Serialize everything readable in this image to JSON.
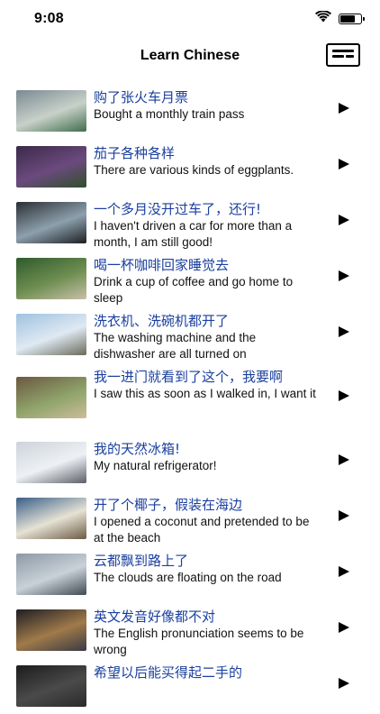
{
  "status_bar": {
    "time": "9:08",
    "battery_level": 0.8
  },
  "nav": {
    "title": "Learn Chinese",
    "menu_icon": "card-menu-icon"
  },
  "lessons": [
    {
      "zh": "购了张火车月票",
      "en": "Bought a monthly train pass",
      "thumb": [
        "#7a8a93",
        "#c8d1c9",
        "#3f6e4a"
      ]
    },
    {
      "zh": "茄子各种各样",
      "en": "There are various kinds of eggplants.",
      "thumb": [
        "#3b2a48",
        "#6b4a7e",
        "#2f4f2a"
      ]
    },
    {
      "zh": "一个多月没开过车了，还行!",
      "en": "I haven't driven a car for more than a month, I am still good!",
      "thumb": [
        "#2b2f35",
        "#8da0ad",
        "#1d1f22"
      ]
    },
    {
      "zh": "喝一杯咖啡回家睡觉去",
      "en": "Drink a cup of coffee and go home to sleep",
      "thumb": [
        "#2f5a2c",
        "#6f8f52",
        "#c8c0a8"
      ]
    },
    {
      "zh": "洗衣机、洗碗机都开了",
      "en": "The washing machine and the dishwasher are all turned on",
      "thumb": [
        "#9fc2e0",
        "#dfe9f2",
        "#6a6a5a"
      ]
    },
    {
      "zh": "我一进门就看到了这个，我要啊",
      "en": "I saw this as soon as I walked in, I want it",
      "thumb": [
        "#6b5840",
        "#8fa36a",
        "#cbbd9a"
      ]
    },
    {
      "zh": "我的天然冰箱!",
      "en": "My natural refrigerator!",
      "thumb": [
        "#cdd3da",
        "#eef1f4",
        "#5a5f66"
      ]
    },
    {
      "zh": "开了个椰子，假装在海边",
      "en": "I opened a coconut and pretended to be at the beach",
      "thumb": [
        "#3a5f8a",
        "#e6e2d4",
        "#6b5a44"
      ]
    },
    {
      "zh": "云都飘到路上了",
      "en": "The clouds are floating on the road",
      "thumb": [
        "#8c99a6",
        "#c9d1d8",
        "#3f4a52"
      ]
    },
    {
      "zh": "英文发音好像都不对",
      "en": "The English pronunciation seems to be wrong",
      "thumb": [
        "#1e1e24",
        "#a07a4a",
        "#3a3a44"
      ]
    },
    {
      "zh": "希望以后能买得起二手的",
      "en": "",
      "thumb": [
        "#1c1c1c",
        "#4a4a4a",
        "#2a2a2a"
      ]
    }
  ]
}
